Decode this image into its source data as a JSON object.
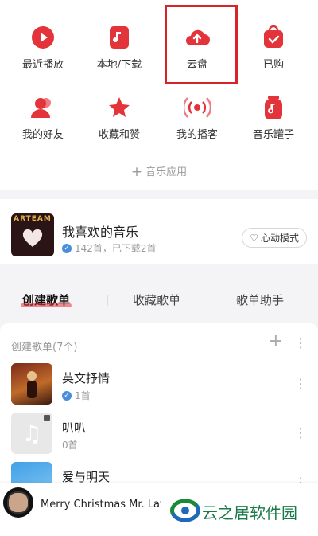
{
  "quick_grid": [
    {
      "label": "最近播放",
      "icon": "play-circle-icon"
    },
    {
      "label": "本地/下载",
      "icon": "music-file-icon"
    },
    {
      "label": "云盘",
      "icon": "cloud-upload-icon"
    },
    {
      "label": "已购",
      "icon": "shopping-bag-icon"
    },
    {
      "label": "我的好友",
      "icon": "friends-icon"
    },
    {
      "label": "收藏和赞",
      "icon": "star-icon"
    },
    {
      "label": "我的播客",
      "icon": "podcast-icon"
    },
    {
      "label": "音乐罐子",
      "icon": "music-jar-icon"
    }
  ],
  "music_apps": {
    "label": "音乐应用",
    "icon": "plus-icon"
  },
  "liked": {
    "title": "我喜欢的音乐",
    "subtitle": "142首，已下载2首",
    "heart_mode": "心动模式",
    "cover_text": "ARTEAM"
  },
  "tabs": [
    {
      "label": "创建歌单"
    },
    {
      "label": "收藏歌单"
    },
    {
      "label": "歌单助手"
    }
  ],
  "playlists": {
    "header": "创建歌单(7个)",
    "items": [
      {
        "name": "英文抒情",
        "count": "1首"
      },
      {
        "name": "叭叭",
        "count": "0首"
      },
      {
        "name": "爱与明天",
        "count": ""
      }
    ]
  },
  "player": {
    "song": "Merry Christmas Mr. Lav"
  },
  "watermark": {
    "text": "云之居软件园"
  },
  "colors": {
    "accent": "#e3343c",
    "highlight": "#d9232a"
  }
}
